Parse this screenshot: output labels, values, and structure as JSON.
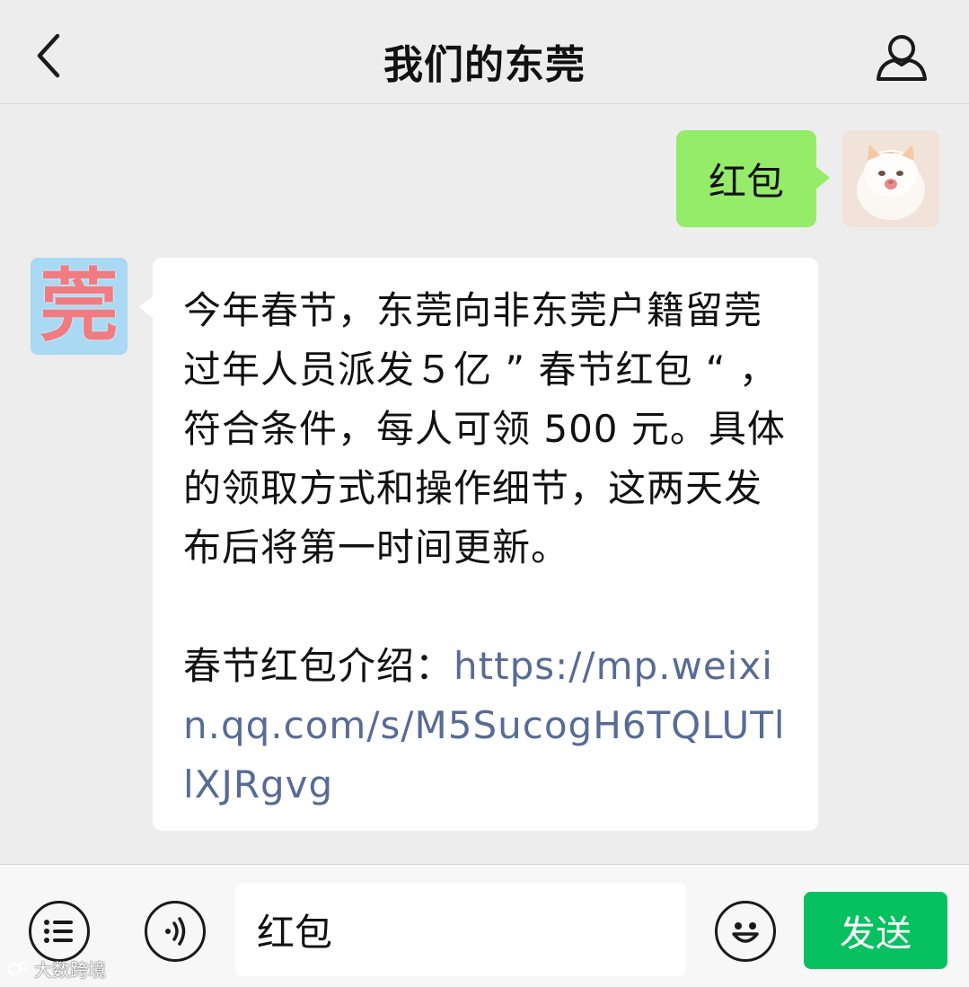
{
  "header": {
    "title": "我们的东莞",
    "back_icon": "chevron-left-icon",
    "profile_icon": "person-icon"
  },
  "messages": [
    {
      "side": "right",
      "text": "红包",
      "bubble_color": "#95ec69"
    },
    {
      "side": "left",
      "avatar_text": "莞",
      "body": "今年春节，东莞向非东莞户籍留莞过年人员派发５亿 ” 春节红包 “ ，符合条件，每人可领 500 元。具体的领取方式和操作细节，这两天发布后将第一时间更新。",
      "intro_label": "春节红包介绍：",
      "link": "https://mp.weixin.qq.com/s/M5SucogH6TQLUTllXJRgvg",
      "link_color": "#576b95"
    }
  ],
  "input_bar": {
    "menu_icon": "menu-list-icon",
    "voice_icon": "voice-icon",
    "input_value": "红包",
    "emoji_icon": "emoji-icon",
    "send_label": "发送",
    "send_color": "#07c160"
  },
  "watermark": {
    "text": "大数跨境"
  }
}
